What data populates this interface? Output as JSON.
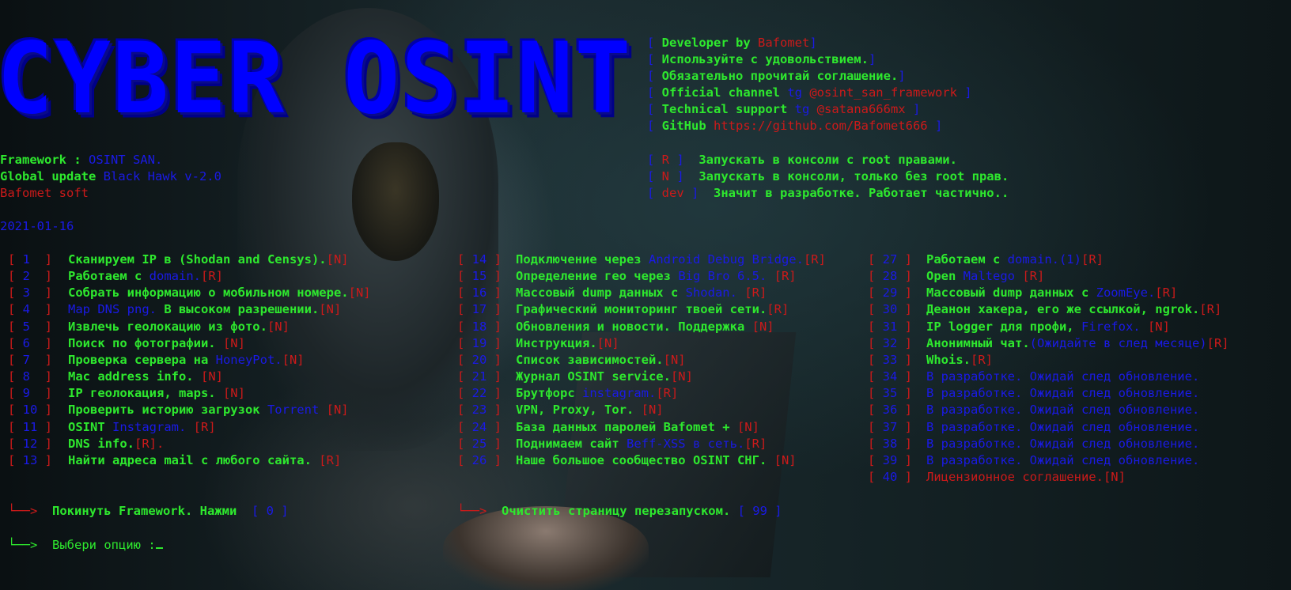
{
  "banner": "CYBER OSINT",
  "info": [
    {
      "pre": "[ ",
      "label": "Developer by ",
      "value": "Bafomet",
      "post": "]"
    },
    {
      "pre": "[ ",
      "label": "Используйте с удовольствием.",
      "value": "",
      "post": "]"
    },
    {
      "pre": "[ ",
      "label": "Обязательно прочитай соглашение.",
      "value": "",
      "post": "]"
    },
    {
      "pre": "[ ",
      "label": "Official channel ",
      "tg": "tg ",
      "value": "@osint_san_framework",
      "post": " ]"
    },
    {
      "pre": "[ ",
      "label": "Technical support ",
      "tg": "tg ",
      "value": "@satana666mx",
      "post": " ]"
    },
    {
      "pre": "[ ",
      "label": "GitHub ",
      "value": "https://github.com/Bafomet666",
      "post": " ]"
    }
  ],
  "framework": {
    "label1": "Framework : ",
    "value1": "OSINT SAN.",
    "label2": "Global update ",
    "value2": "Black Hawk v-2.0",
    "soft": "Bafomet soft",
    "date": "2021-01-16"
  },
  "legend": [
    {
      "open": "[ ",
      "code": "R",
      "close": " ]",
      "text": "  Запускать в консоли с root правами."
    },
    {
      "open": "[ ",
      "code": "N",
      "close": " ]",
      "text": "  Запускать в консоли, только без root прав."
    },
    {
      "open": "[ ",
      "code": "dev",
      "close": " ]",
      "text": "  Значит в разработке. Работает частично.."
    }
  ],
  "menu_col1": [
    {
      "num": "1",
      "parts": [
        [
          "g",
          "Сканируем IP в (Shodan and Censys)."
        ],
        [
          "r",
          "[N]"
        ]
      ]
    },
    {
      "num": "2",
      "parts": [
        [
          "g",
          "Работаем с "
        ],
        [
          "b",
          "domain."
        ],
        [
          "r",
          "[R]"
        ]
      ]
    },
    {
      "num": "3",
      "parts": [
        [
          "g",
          "Собрать информацию о мобильном номере."
        ],
        [
          "r",
          "[N]"
        ]
      ]
    },
    {
      "num": "4",
      "parts": [
        [
          "b",
          "Map DNS png."
        ],
        [
          "g",
          " В высоком разрешении."
        ],
        [
          "r",
          "[N]"
        ]
      ]
    },
    {
      "num": "5",
      "parts": [
        [
          "g",
          "Извлечь геолокацию из фото."
        ],
        [
          "r",
          "[N]"
        ]
      ]
    },
    {
      "num": "6",
      "parts": [
        [
          "g",
          "Поиск по фотографии. "
        ],
        [
          "r",
          "[N]"
        ]
      ]
    },
    {
      "num": "7",
      "parts": [
        [
          "g",
          "Проверка сервера на "
        ],
        [
          "b",
          "HoneyPot."
        ],
        [
          "r",
          "[N]"
        ]
      ]
    },
    {
      "num": "8",
      "parts": [
        [
          "g",
          "Mac address info. "
        ],
        [
          "r",
          "[N]"
        ]
      ]
    },
    {
      "num": "9",
      "parts": [
        [
          "g",
          "IP геолокация, maps. "
        ],
        [
          "r",
          "[N]"
        ]
      ]
    },
    {
      "num": "10",
      "parts": [
        [
          "g",
          "Проверить историю загрузок "
        ],
        [
          "b",
          "Torrent "
        ],
        [
          "r",
          "[N]"
        ]
      ]
    },
    {
      "num": "11",
      "parts": [
        [
          "g",
          "OSINT "
        ],
        [
          "b",
          "Instagram. "
        ],
        [
          "r",
          "[R]"
        ]
      ]
    },
    {
      "num": "12",
      "parts": [
        [
          "g",
          "DNS info."
        ],
        [
          "r",
          "[R]."
        ]
      ]
    },
    {
      "num": "13",
      "parts": [
        [
          "g",
          "Найти адреса mail с любого сайта. "
        ],
        [
          "r",
          "[R]"
        ]
      ]
    }
  ],
  "menu_col2": [
    {
      "num": "14",
      "parts": [
        [
          "g",
          "Подключение через "
        ],
        [
          "b",
          "Android Debug Bridge."
        ],
        [
          "r",
          "[R]"
        ]
      ]
    },
    {
      "num": "15",
      "parts": [
        [
          "g",
          "Определение гео через "
        ],
        [
          "b",
          "Big Bro 6.5. "
        ],
        [
          "r",
          "[R]"
        ]
      ]
    },
    {
      "num": "16",
      "parts": [
        [
          "g",
          "Массовый dump данных с "
        ],
        [
          "b",
          "Shodan. "
        ],
        [
          "r",
          "[R]"
        ]
      ]
    },
    {
      "num": "17",
      "parts": [
        [
          "g",
          "Графический мониторинг твоей сети."
        ],
        [
          "r",
          "[R]"
        ]
      ]
    },
    {
      "num": "18",
      "parts": [
        [
          "g",
          "Обновления и новости. Поддержка "
        ],
        [
          "r",
          "[N]"
        ]
      ]
    },
    {
      "num": "19",
      "parts": [
        [
          "g",
          "Инструкция."
        ],
        [
          "r",
          "[N]"
        ]
      ]
    },
    {
      "num": "20",
      "parts": [
        [
          "g",
          "Список зависимостей."
        ],
        [
          "r",
          "[N]"
        ]
      ]
    },
    {
      "num": "21",
      "parts": [
        [
          "g",
          "Журнал OSINT service."
        ],
        [
          "r",
          "[N]"
        ]
      ]
    },
    {
      "num": "22",
      "parts": [
        [
          "g",
          "Брутфорс "
        ],
        [
          "b",
          "instagram."
        ],
        [
          "r",
          "[R]"
        ]
      ]
    },
    {
      "num": "23",
      "parts": [
        [
          "g",
          "VPN, Proxy, Tor. "
        ],
        [
          "r",
          "[N]"
        ]
      ]
    },
    {
      "num": "24",
      "parts": [
        [
          "g",
          "База данных паролей Bafomet + "
        ],
        [
          "r",
          "[N]"
        ]
      ]
    },
    {
      "num": "25",
      "parts": [
        [
          "g",
          "Поднимаем сайт "
        ],
        [
          "b",
          "Beff-XSS в сеть."
        ],
        [
          "r",
          "[R]"
        ]
      ]
    },
    {
      "num": "26",
      "parts": [
        [
          "g",
          "Наше большое сообщество OSINT СНГ. "
        ],
        [
          "r",
          "[N]"
        ]
      ]
    }
  ],
  "menu_col3": [
    {
      "num": "27",
      "parts": [
        [
          "g",
          "Работаем с "
        ],
        [
          "b",
          "domain.(1)"
        ],
        [
          "r",
          "[R]"
        ]
      ]
    },
    {
      "num": "28",
      "parts": [
        [
          "g",
          "Open "
        ],
        [
          "b",
          "Maltego "
        ],
        [
          "r",
          "[R]"
        ]
      ]
    },
    {
      "num": "29",
      "parts": [
        [
          "g",
          "Массовый dump данных с "
        ],
        [
          "b",
          "ZoomEye."
        ],
        [
          "r",
          "[R]"
        ]
      ]
    },
    {
      "num": "30",
      "parts": [
        [
          "g",
          "Деанон хакера, его же ссылкой, ngrok."
        ],
        [
          "r",
          "[R]"
        ]
      ]
    },
    {
      "num": "31",
      "parts": [
        [
          "g",
          "IP logger для профи, "
        ],
        [
          "b",
          "Firefox. "
        ],
        [
          "r",
          "[N]"
        ]
      ]
    },
    {
      "num": "32",
      "parts": [
        [
          "g",
          "Анонимный чат."
        ],
        [
          "b",
          "(Ожидайте в след месяце)"
        ],
        [
          "r",
          "[R]"
        ]
      ]
    },
    {
      "num": "33",
      "parts": [
        [
          "g",
          "Whois."
        ],
        [
          "r",
          "[R]"
        ]
      ]
    },
    {
      "num": "34",
      "parts": [
        [
          "b",
          "В разработке. Ожидай след обновление."
        ]
      ]
    },
    {
      "num": "35",
      "parts": [
        [
          "b",
          "В разработке. Ожидай след обновление."
        ]
      ]
    },
    {
      "num": "36",
      "parts": [
        [
          "b",
          "В разработке. Ожидай след обновление."
        ]
      ]
    },
    {
      "num": "37",
      "parts": [
        [
          "b",
          "В разработке. Ожидай след обновление."
        ]
      ]
    },
    {
      "num": "38",
      "parts": [
        [
          "b",
          "В разработке. Ожидай след обновление."
        ]
      ]
    },
    {
      "num": "39",
      "parts": [
        [
          "b",
          "В разработке. Ожидай след обновление."
        ]
      ]
    },
    {
      "num": "40",
      "parts": [
        [
          "r",
          "Лицензионное соглашение."
        ],
        [
          "r",
          "[N]"
        ]
      ]
    }
  ],
  "footer": {
    "arrow": "└──>",
    "exit_text": "Покинуть Framework. Нажми ",
    "exit_code": "[ 0 ]",
    "clear_text": "Очистить страницу перезапуском. ",
    "clear_code": "[ 99 ]",
    "prompt": "Выбери опцию :"
  },
  "colors": {
    "green": "#2ee82e",
    "blue": "#1a1ae6",
    "red": "#cc1a1a"
  }
}
